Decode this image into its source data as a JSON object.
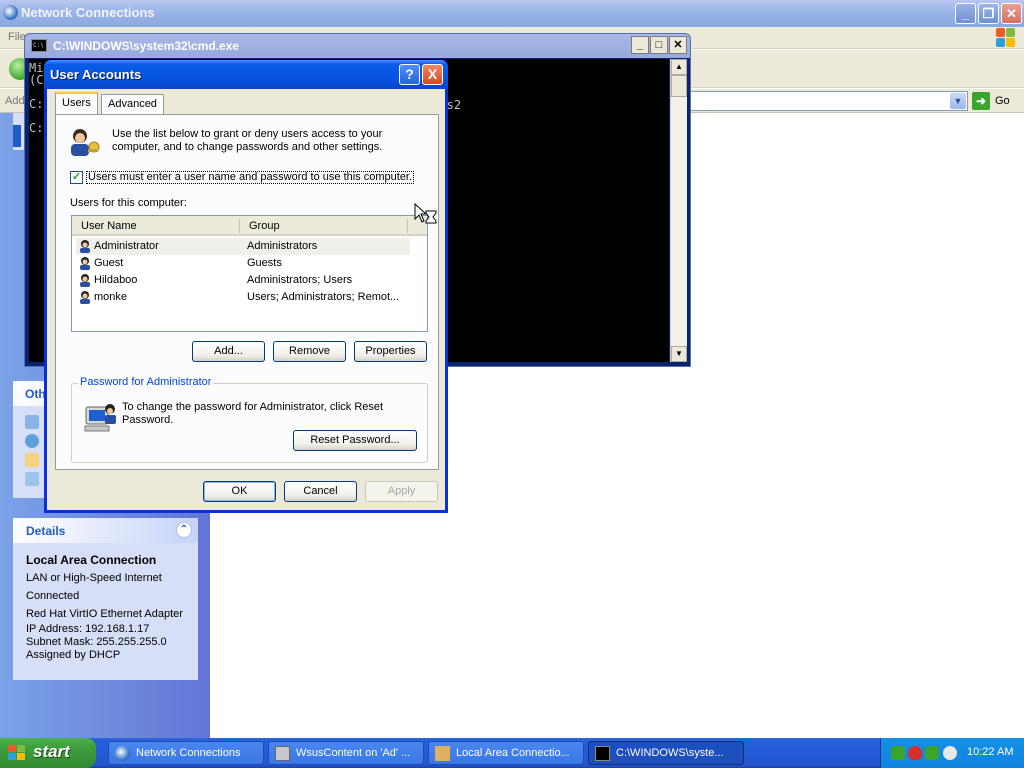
{
  "network_window": {
    "title": "Network Connections",
    "menu_partial": "File",
    "address_label_partial": "Add",
    "go_label": "Go",
    "other_places_partial": "Oth",
    "details": {
      "header": "Details",
      "name": "Local Area Connection",
      "type": "LAN or High-Speed Internet",
      "status": "Connected",
      "adapter": "Red Hat VirtIO Ethernet Adapter",
      "ip": "IP Address: 192.168.1.17",
      "mask": "Subnet Mask: 255.255.255.0",
      "assigned": "Assigned by DHCP"
    }
  },
  "cmd_window": {
    "title": "C:\\WINDOWS\\system32\\cmd.exe",
    "icon_text": "C:\\",
    "lines": [
      "Mi",
      "(C",
      "",
      "C:",
      "",
      "C:"
    ],
    "visible_text_right": "ords2"
  },
  "user_accounts": {
    "title": "User Accounts",
    "help_glyph": "?",
    "close_glyph": "X",
    "tabs": [
      "Users",
      "Advanced"
    ],
    "intro": "Use the list below to grant or deny users access to your computer, and to change passwords and other settings.",
    "checkbox_label": "Users must enter a user name and password to use this computer.",
    "checkbox_checked": true,
    "users_label": "Users for this computer:",
    "columns": [
      "User Name",
      "Group"
    ],
    "users": [
      {
        "name": "Administrator",
        "group": "Administrators"
      },
      {
        "name": "Guest",
        "group": "Guests"
      },
      {
        "name": "Hildaboo",
        "group": "Administrators; Users"
      },
      {
        "name": "monke",
        "group": "Users; Administrators; Remot..."
      }
    ],
    "buttons": {
      "add": "Add...",
      "remove": "Remove",
      "properties": "Properties"
    },
    "password_group_title": "Password for Administrator",
    "password_text": "To change the password for Administrator, click Reset Password.",
    "reset_button": "Reset Password...",
    "ok": "OK",
    "cancel": "Cancel",
    "apply": "Apply"
  },
  "taskbar": {
    "start": "start",
    "tasks": [
      "Network Connections",
      "WsusContent on 'Ad' ...",
      "Local Area Connectio...",
      "C:\\WINDOWS\\syste..."
    ],
    "clock": "10:22 AM"
  },
  "colors": {
    "xp_blue_title": "#0554e3",
    "taskbar_blue": "#245edc",
    "start_green": "#3c9b3c",
    "details_link": "#215dc6"
  }
}
